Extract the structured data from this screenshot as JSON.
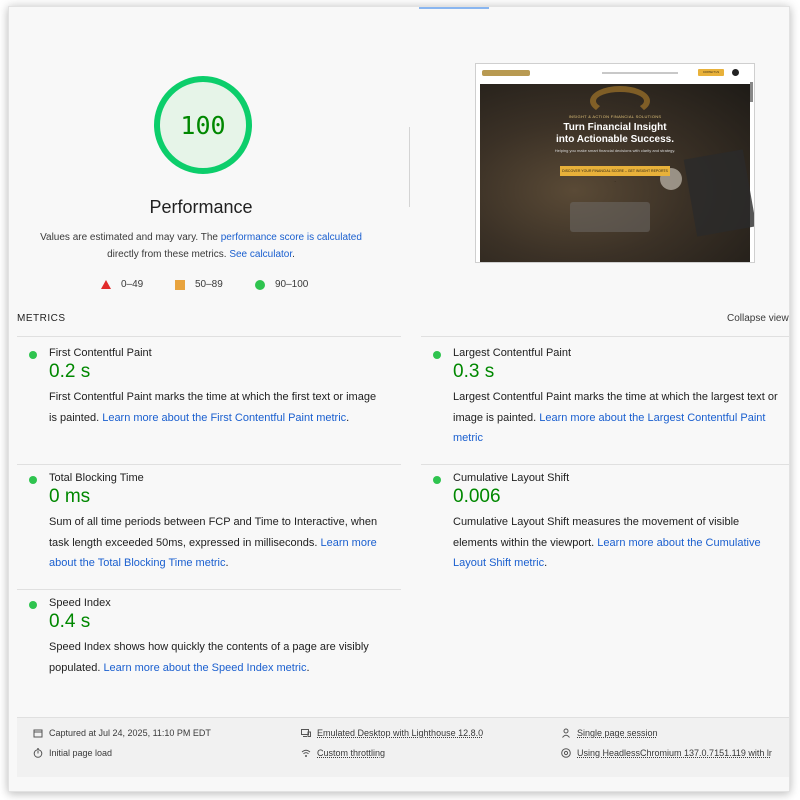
{
  "gauge": {
    "score": "100",
    "score_value": 100,
    "color": "#0cce6b",
    "title": "Performance"
  },
  "description": {
    "part1": "Values are estimated and may vary. The ",
    "link1": "performance score is calculated",
    "part2": " directly from these metrics. ",
    "link2": "See calculator",
    "part3": "."
  },
  "legend": [
    {
      "range": "0–49",
      "shape": "triangle",
      "color": "#e22b2b"
    },
    {
      "range": "50–89",
      "shape": "square",
      "color": "#e8a33e"
    },
    {
      "range": "90–100",
      "shape": "circle",
      "color": "#2fc44f"
    }
  ],
  "screenshot": {
    "eyebrow": "INSIGHT & ACTION FINANCIAL SOLUTIONS",
    "headline_line1": "Turn Financial Insight",
    "headline_line2": "into Actionable Success.",
    "subtext": "Helping you make smart financial decisions with clarity and strategy.",
    "button": "DISCOVER YOUR FINANCIAL SCORE – GET INSIGHT REPORTS →",
    "nav_cta": "CONTACT US"
  },
  "metrics": {
    "header": "METRICS",
    "collapse": "Collapse view",
    "items": [
      {
        "title": "First Contentful Paint",
        "value": "0.2 s",
        "desc": "First Contentful Paint marks the time at which the first text or image is painted. ",
        "link": "Learn more about the First Contentful Paint metric",
        "end": "."
      },
      {
        "title": "Largest Contentful Paint",
        "value": "0.3 s",
        "desc": "Largest Contentful Paint marks the time at which the largest text or image is painted. ",
        "link": "Learn more about the Largest Contentful Paint metric",
        "end": ""
      },
      {
        "title": "Total Blocking Time",
        "value": "0 ms",
        "desc": "Sum of all time periods between FCP and Time to Interactive, when task length exceeded 50ms, expressed in milliseconds. ",
        "link": "Learn more about the Total Blocking Time metric",
        "end": "."
      },
      {
        "title": "Cumulative Layout Shift",
        "value": "0.006",
        "desc": "Cumulative Layout Shift measures the movement of visible elements within the viewport. ",
        "link": "Learn more about the Cumulative Layout Shift metric",
        "end": "."
      },
      {
        "title": "Speed Index",
        "value": "0.4 s",
        "desc": "Speed Index shows how quickly the contents of a page are visibly populated. ",
        "link": "Learn more about the Speed Index metric",
        "end": "."
      }
    ]
  },
  "footer": {
    "captured": "Captured at Jul 24, 2025, 11:10 PM EDT",
    "page_load": "Initial page load",
    "emulated": "Emulated Desktop with Lighthouse 12.8.0",
    "throttling": "Custom throttling",
    "session": "Single page session",
    "browser": "Using HeadlessChromium 137.0.7151.119 with lr"
  },
  "colors": {
    "pass": "#2fc44f",
    "pass_text": "#008800",
    "link": "#1a5fcf"
  }
}
